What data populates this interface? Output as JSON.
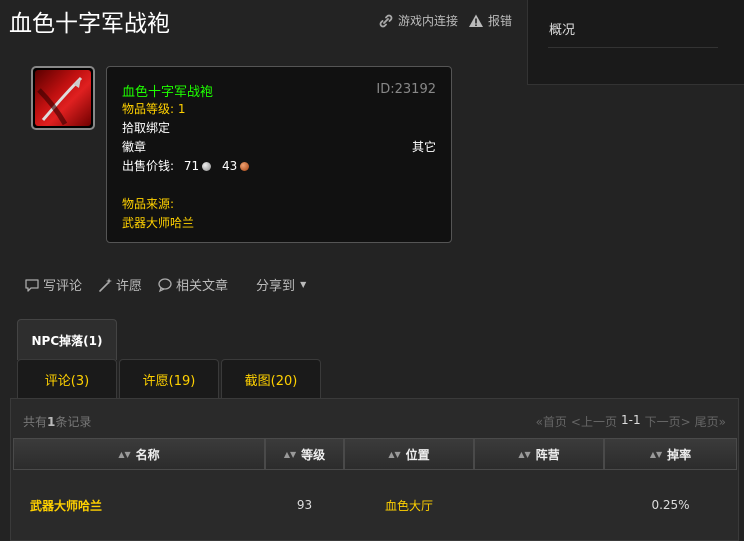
{
  "page": {
    "title": "血色十字军战袍"
  },
  "top_actions": {
    "ingame_link": "游戏内连接",
    "report": "报错"
  },
  "overview": {
    "title": "概况"
  },
  "item": {
    "icon": "tabard-icon",
    "name": "血色十字军战袍",
    "id_text": "ID:23192",
    "level": "物品等级: 1",
    "bind": "拾取绑定",
    "slot": "徽章",
    "type": "其它",
    "sell_label": "出售价钱:",
    "silver": "71",
    "copper": "43",
    "source_label": "物品来源:",
    "source": "武器大师哈兰",
    "name_color": "#1eff00",
    "level_color": "#ffd100"
  },
  "actions": {
    "comment": "写评论",
    "wish": "许愿",
    "related": "相关文章",
    "share": "分享到"
  },
  "tabs": {
    "main": "NPC掉落(1)",
    "sub": [
      "评论(3)",
      "许愿(19)",
      "截图(20)"
    ]
  },
  "table": {
    "record_prefix": "共有",
    "record_count": "1",
    "record_suffix": "条记录",
    "pager": {
      "first": "«首页",
      "prev": "<上一页",
      "current": "1-1",
      "next": "下一页>",
      "last": "尾页»"
    },
    "headers": [
      "名称",
      "等级",
      "位置",
      "阵营",
      "掉率"
    ],
    "rows": [
      {
        "name": "武器大师哈兰",
        "level": "93",
        "location": "血色大厅",
        "faction": "",
        "rate": "0.25%"
      }
    ]
  }
}
